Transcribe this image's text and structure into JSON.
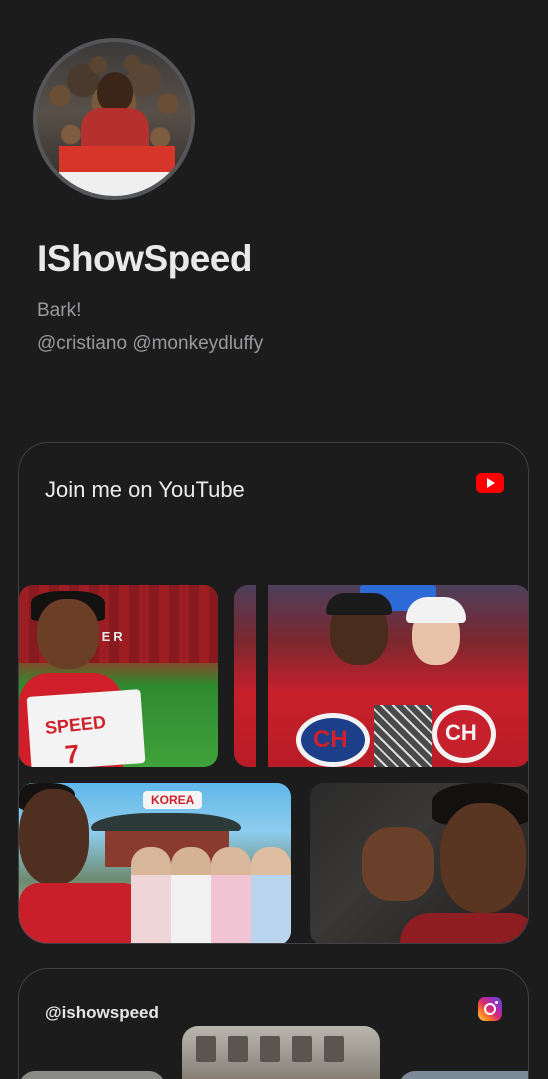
{
  "profile": {
    "name": "IShowSpeed",
    "bio_line_1": "Bark!",
    "bio_line_2": "@cristiano @monkeydluffy",
    "avatar_alt": "avatar"
  },
  "youtube_card": {
    "title": "Join me on YouTube",
    "icon": "youtube-icon",
    "icon_color": "#ff0000",
    "thumbnails": [
      {
        "label_text": "STER",
        "jersey_name": "SPEED",
        "jersey_number": "7"
      },
      {
        "logo_text": "CH"
      },
      {
        "location_tag": "KOREA"
      },
      {}
    ]
  },
  "instagram_card": {
    "handle": "@ishowspeed",
    "icon": "instagram-icon"
  },
  "colors": {
    "background": "#1c1c1d",
    "card_border": "#414145",
    "text_primary": "#e9e9ea",
    "text_secondary": "#9a9a9d"
  }
}
